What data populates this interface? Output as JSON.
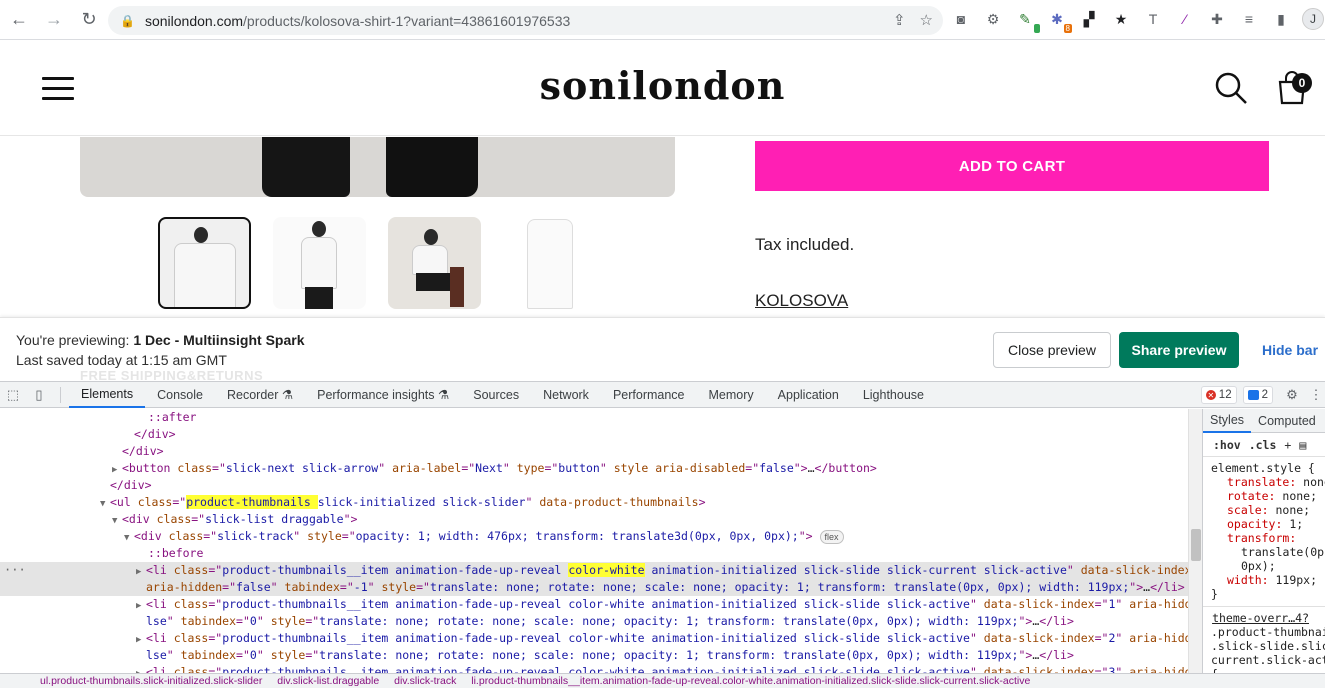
{
  "browser": {
    "url_host": "sonilondon.com",
    "url_path": "/products/kolosova-shirt-1?variant=43861601976533",
    "ext_badge_orange": "8",
    "avatar_letter": "J"
  },
  "site": {
    "logo": "sonilondon",
    "cart_count": "0",
    "add_to_cart": "ADD TO CART",
    "tax_text": "Tax included.",
    "vendor": "KOLOSOVA"
  },
  "preview_bar": {
    "previewing_label": "You're previewing:",
    "theme_name": "1 Dec - Multiinsight Spark",
    "last_saved": "Last saved today at 1:15 am GMT",
    "ghost_text": "FREE SHIPPING&RETURNS",
    "close_preview": "Close preview",
    "share_preview": "Share preview",
    "hide_bar": "Hide bar"
  },
  "devtools": {
    "tabs": [
      "Elements",
      "Console",
      "Recorder",
      "Performance insights",
      "Sources",
      "Network",
      "Performance",
      "Memory",
      "Application",
      "Lighthouse"
    ],
    "errors": "12",
    "messages": "2",
    "styles_tab": "Styles",
    "computed_tab": "Computed",
    "filter_hov": ":hov",
    "filter_cls": ".cls",
    "element_style": "element.style {",
    "style_props": [
      {
        "name": "translate",
        "value": "none"
      },
      {
        "name": "rotate",
        "value": "none;"
      },
      {
        "name": "scale",
        "value": "none;"
      },
      {
        "name": "opacity",
        "value": "1;"
      },
      {
        "name": "transform",
        "value": ""
      },
      {
        "name": "",
        "value": "translate(0p"
      },
      {
        "name": "",
        "value": "0px);"
      },
      {
        "name": "width",
        "value": "119px;"
      }
    ],
    "close_brace": "}",
    "source_link": "theme-overr…4?",
    "selector_lines": [
      ".product-thumbnai",
      ".slick-slide.slick",
      "current.slick-acti",
      "{"
    ],
    "breadcrumbs": [
      "ul.product-thumbnails.slick-initialized.slick-slider",
      "div.slick-list.draggable",
      "div.slick-track",
      "li.product-thumbnails__item.animation-fade-up-reveal.color-white.animation-initialized.slick-slide.slick-current.slick-active"
    ]
  }
}
